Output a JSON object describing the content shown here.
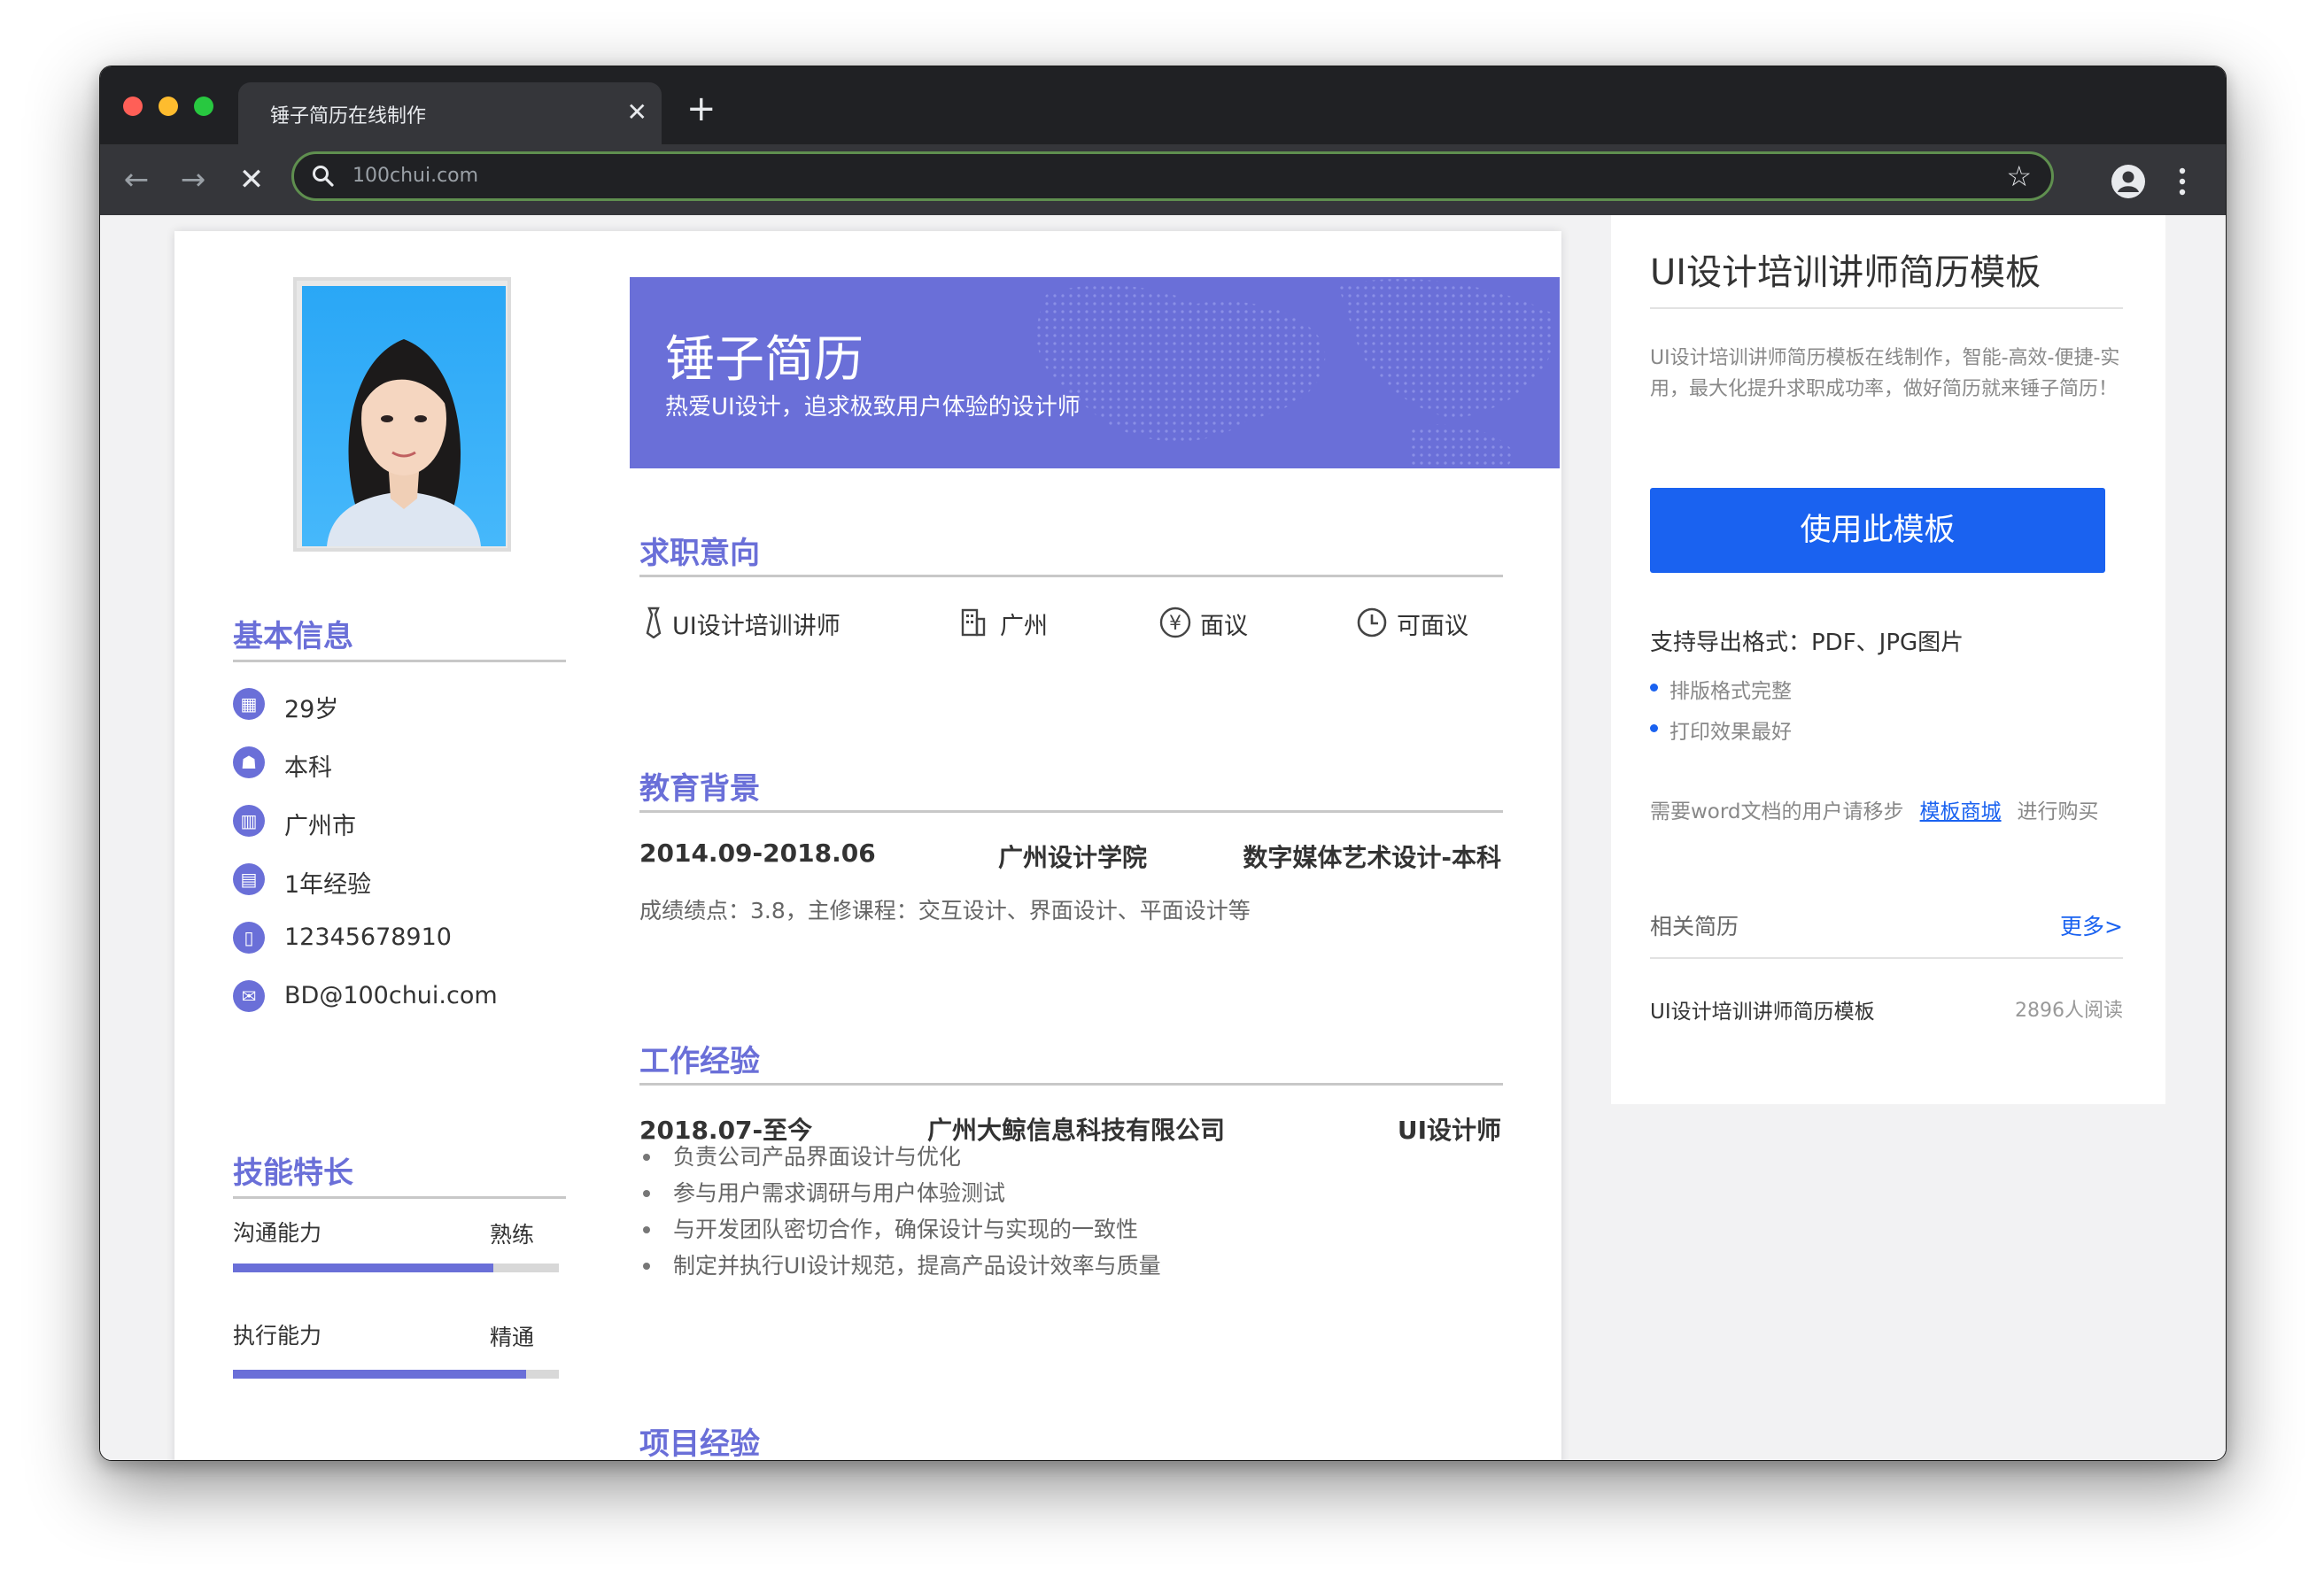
{
  "browser": {
    "tab_title": "锤子简历在线制作",
    "url": "100chui.com",
    "colors": {
      "frame": "#202124",
      "toolbar": "#35363a",
      "omnibox_border": "#5f8f4f"
    }
  },
  "resume": {
    "name": "锤子简历",
    "tagline": "热爱UI设计，追求极致用户体验的设计师",
    "accent_color": "#6a6fd8",
    "basic_info": {
      "title": "基本信息",
      "items": [
        {
          "icon": "calendar-icon",
          "text": "29岁"
        },
        {
          "icon": "graduation-cap-icon",
          "text": "本科"
        },
        {
          "icon": "building-icon",
          "text": "广州市"
        },
        {
          "icon": "document-icon",
          "text": "1年经验"
        },
        {
          "icon": "phone-icon",
          "text": "12345678910"
        },
        {
          "icon": "mail-icon",
          "text": "BD@100chui.com"
        }
      ]
    },
    "skills": {
      "title": "技能特长",
      "items": [
        {
          "name": "沟通能力",
          "level": "熟练",
          "fraction": 0.8
        },
        {
          "name": "执行能力",
          "level": "精通",
          "fraction": 0.9
        }
      ]
    },
    "job_intent": {
      "title": "求职意向",
      "items": [
        {
          "icon": "tie-icon",
          "text": "UI设计培训讲师"
        },
        {
          "icon": "office-building-icon",
          "text": "广州"
        },
        {
          "icon": "yen-icon",
          "text": "面议"
        },
        {
          "icon": "clock-icon",
          "text": "可面议"
        }
      ]
    },
    "education": {
      "title": "教育背景",
      "period": "2014.09-2018.06",
      "school": "广州设计学院",
      "major": "数字媒体艺术设计-本科",
      "detail": "成绩绩点：3.8，主修课程：交互设计、界面设计、平面设计等"
    },
    "work": {
      "title": "工作经验",
      "period": "2018.07-至今",
      "company": "广州大鲸信息科技有限公司",
      "role": "UI设计师",
      "duties": [
        "负责公司产品界面设计与优化",
        "参与用户需求调研与用户体验测试",
        "与开发团队密切合作，确保设计与实现的一致性",
        "制定并执行UI设计规范，提高产品设计效率与质量"
      ]
    },
    "projects": {
      "title": "项目经验"
    }
  },
  "sidebar": {
    "title": "UI设计培训讲师简历模板",
    "description": "UI设计培训讲师简历模板在线制作，智能-高效-便捷-实用，最大化提升求职成功率，做好简历就来锤子简历！",
    "use_button": "使用此模板",
    "button_color": "#1a62f0",
    "export_label": "支持导出格式：PDF、JPG图片",
    "features": [
      "排版格式完整",
      "打印效果最好"
    ],
    "word_note_prefix": "需要word文档的用户请移步",
    "word_link": "模板商城",
    "word_note_suffix": "进行购买",
    "related_label": "相关简历",
    "more_link": "更多>",
    "related_item": {
      "title": "UI设计培训讲师简历模板",
      "reads": "2896人阅读"
    }
  }
}
